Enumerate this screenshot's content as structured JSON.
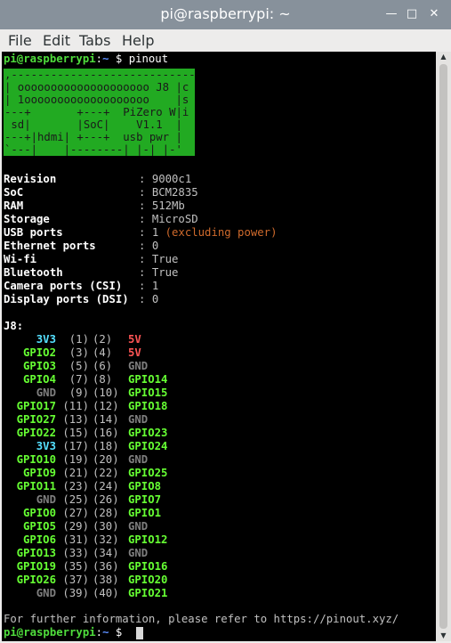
{
  "window": {
    "title": "pi@raspberrypi: ~"
  },
  "menu": [
    "File",
    "Edit",
    "Tabs",
    "Help"
  ],
  "prompt": {
    "user_host": "pi@raspberrypi",
    "sep": ":",
    "path": "~",
    "dollar": " $",
    "command": "pinout"
  },
  "board": {
    "lines": [
      ",--------------------------------.",
      "| oooooooooooooooooooo J8 |c",
      "| 1ooooooooooooooooooo    |s",
      "---+       +---+  PiZero W|i",
      " sd|       |SoC|    V1.1  |",
      "---+|hdmi| +---+  usb pwr |",
      "`---|    |--------| |-| |-'"
    ]
  },
  "info": [
    {
      "label": "Revision",
      "value": "9000c1",
      "extra": ""
    },
    {
      "label": "SoC",
      "value": "BCM2835",
      "extra": ""
    },
    {
      "label": "RAM",
      "value": "512Mb",
      "extra": ""
    },
    {
      "label": "Storage",
      "value": "MicroSD",
      "extra": ""
    },
    {
      "label": "USB ports",
      "value": "1",
      "extra": " (excluding power)"
    },
    {
      "label": "Ethernet ports",
      "value": "0",
      "extra": ""
    },
    {
      "label": "Wi-fi",
      "value": "True",
      "extra": ""
    },
    {
      "label": "Bluetooth",
      "value": "True",
      "extra": ""
    },
    {
      "label": "Camera ports (CSI)",
      "value": "1",
      "extra": ""
    },
    {
      "label": "Display ports (DSI)",
      "value": "0",
      "extra": ""
    }
  ],
  "j8_label": "J8:",
  "pins": [
    {
      "l": "3V3",
      "lc": "cyan",
      "a": "(1)",
      "b": "(2)",
      "r": "5V",
      "rc": "red"
    },
    {
      "l": "GPIO2",
      "lc": "lime",
      "a": "(3)",
      "b": "(4)",
      "r": "5V",
      "rc": "red"
    },
    {
      "l": "GPIO3",
      "lc": "lime",
      "a": "(5)",
      "b": "(6)",
      "r": "GND",
      "rc": "dgrey"
    },
    {
      "l": "GPIO4",
      "lc": "lime",
      "a": "(7)",
      "b": "(8)",
      "r": "GPIO14",
      "rc": "lime"
    },
    {
      "l": "GND",
      "lc": "dgrey",
      "a": "(9)",
      "b": "(10)",
      "r": "GPIO15",
      "rc": "lime"
    },
    {
      "l": "GPIO17",
      "lc": "lime",
      "a": "(11)",
      "b": "(12)",
      "r": "GPIO18",
      "rc": "lime"
    },
    {
      "l": "GPIO27",
      "lc": "lime",
      "a": "(13)",
      "b": "(14)",
      "r": "GND",
      "rc": "dgrey"
    },
    {
      "l": "GPIO22",
      "lc": "lime",
      "a": "(15)",
      "b": "(16)",
      "r": "GPIO23",
      "rc": "lime"
    },
    {
      "l": "3V3",
      "lc": "cyan",
      "a": "(17)",
      "b": "(18)",
      "r": "GPIO24",
      "rc": "lime"
    },
    {
      "l": "GPIO10",
      "lc": "lime",
      "a": "(19)",
      "b": "(20)",
      "r": "GND",
      "rc": "dgrey"
    },
    {
      "l": "GPIO9",
      "lc": "lime",
      "a": "(21)",
      "b": "(22)",
      "r": "GPIO25",
      "rc": "lime"
    },
    {
      "l": "GPIO11",
      "lc": "lime",
      "a": "(23)",
      "b": "(24)",
      "r": "GPIO8",
      "rc": "lime"
    },
    {
      "l": "GND",
      "lc": "dgrey",
      "a": "(25)",
      "b": "(26)",
      "r": "GPIO7",
      "rc": "lime"
    },
    {
      "l": "GPIO0",
      "lc": "lime",
      "a": "(27)",
      "b": "(28)",
      "r": "GPIO1",
      "rc": "lime"
    },
    {
      "l": "GPIO5",
      "lc": "lime",
      "a": "(29)",
      "b": "(30)",
      "r": "GND",
      "rc": "dgrey"
    },
    {
      "l": "GPIO6",
      "lc": "lime",
      "a": "(31)",
      "b": "(32)",
      "r": "GPIO12",
      "rc": "lime"
    },
    {
      "l": "GPIO13",
      "lc": "lime",
      "a": "(33)",
      "b": "(34)",
      "r": "GND",
      "rc": "dgrey"
    },
    {
      "l": "GPIO19",
      "lc": "lime",
      "a": "(35)",
      "b": "(36)",
      "r": "GPIO16",
      "rc": "lime"
    },
    {
      "l": "GPIO26",
      "lc": "lime",
      "a": "(37)",
      "b": "(38)",
      "r": "GPIO20",
      "rc": "lime"
    },
    {
      "l": "GND",
      "lc": "dgrey",
      "a": "(39)",
      "b": "(40)",
      "r": "GPIO21",
      "rc": "lime"
    }
  ],
  "footer": "For further information, please refer to https://pinout.xyz/",
  "colors": {
    "prompt_user": "#4fdd3c",
    "prompt_path": "#5c8fff",
    "board": "#22aa22",
    "orange": "#cf6a2c"
  }
}
